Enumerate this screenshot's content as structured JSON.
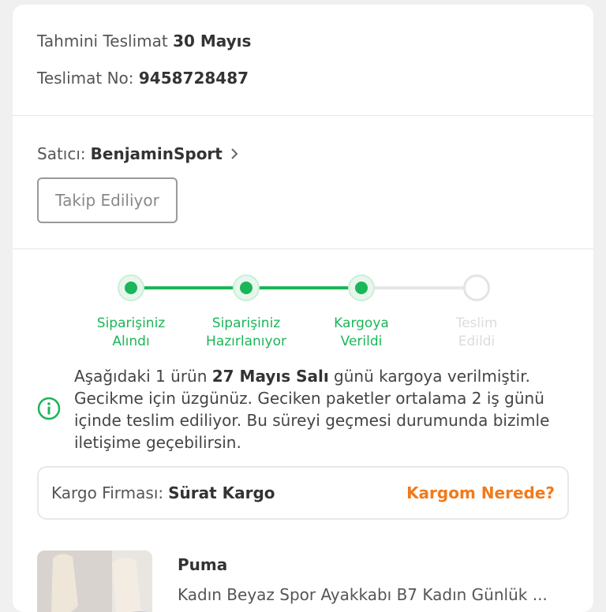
{
  "delivery": {
    "estimate_label": "Tahmini Teslimat",
    "estimate_value": "30 Mayıs",
    "number_label": "Teslimat No:",
    "number_value": "9458728487"
  },
  "seller": {
    "label": "Satıcı:",
    "name": "BenjaminSport",
    "follow_button": "Takip Ediliyor"
  },
  "tracking": {
    "steps": [
      {
        "line1": "Siparişiniz",
        "line2": "Alındı",
        "done": true
      },
      {
        "line1": "Siparişiniz",
        "line2": "Hazırlanıyor",
        "done": true
      },
      {
        "line1": "Kargoya",
        "line2": "Verildi",
        "done": true
      },
      {
        "line1": "Teslim",
        "line2": "Edildi",
        "done": false
      }
    ],
    "colors": {
      "done": "#1bb657",
      "pending": "#dcdcdc"
    }
  },
  "info": {
    "part1": "Aşağıdaki 1 ürün ",
    "bold": "27 Mayıs Salı",
    "part2": " günü kargoya verilmiştir. Gecikme için üzgünüz. Geciken paketler ortalama 2 iş günü içinde teslim ediliyor. Bu süreyi geçmesi durumunda bizimle iletişime geçebilirsin.",
    "icon": "info-circle-icon"
  },
  "cargo": {
    "label": "Kargo Firması:",
    "company": "Sürat Kargo",
    "link": "Kargom Nerede?",
    "link_color": "#f27a1a"
  },
  "product": {
    "brand": "Puma",
    "name": "Kadın Beyaz Spor Ayakkabı B7 Kadın Günlük ..."
  }
}
